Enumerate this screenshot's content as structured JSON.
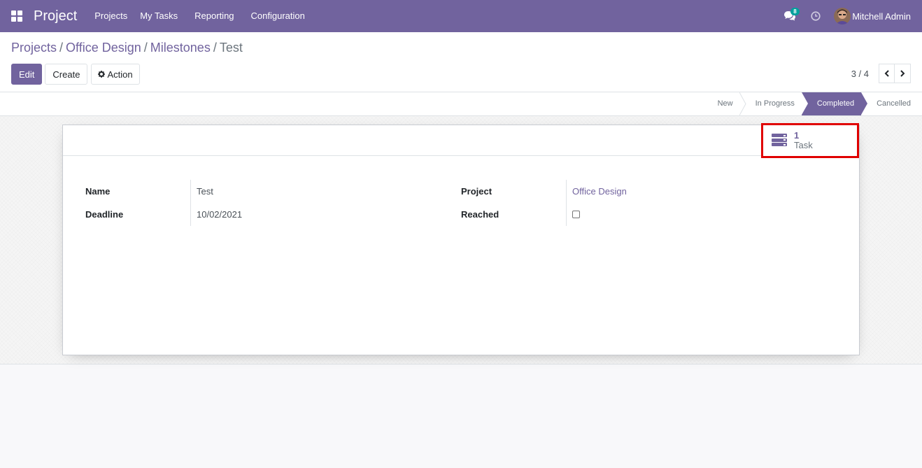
{
  "navbar": {
    "app_title": "Project",
    "menu": [
      "Projects",
      "My Tasks",
      "Reporting",
      "Configuration"
    ],
    "messages_count": "8",
    "user_name": "Mitchell Admin",
    "bg_color": "#71639e"
  },
  "breadcrumb": {
    "items": [
      "Projects",
      "Office Design",
      "Milestones"
    ],
    "current": "Test"
  },
  "buttons": {
    "edit": "Edit",
    "create": "Create",
    "action": "Action"
  },
  "pager": {
    "value": "3 / 4"
  },
  "stages": {
    "items": [
      "New",
      "In Progress",
      "Completed",
      "Cancelled"
    ],
    "active": "Completed"
  },
  "smart_button": {
    "value": "1",
    "label": "Task",
    "icon": "tasks-icon"
  },
  "fields": {
    "name_label": "Name",
    "name_value": "Test",
    "deadline_label": "Deadline",
    "deadline_value": "10/02/2021",
    "project_label": "Project",
    "project_value": "Office Design",
    "reached_label": "Reached",
    "reached_checked": false
  }
}
